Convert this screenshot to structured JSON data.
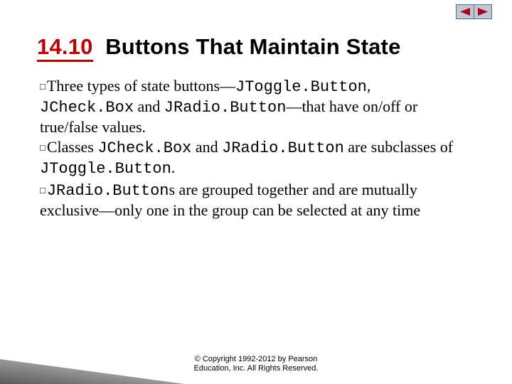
{
  "title": {
    "number": "14.10",
    "text": "Buttons That Maintain State"
  },
  "bullets": [
    {
      "runs": [
        {
          "t": "Three types of state buttons—"
        },
        {
          "t": "JToggle.Button",
          "mono": true
        },
        {
          "t": ", "
        },
        {
          "t": "JCheck.Box",
          "mono": true
        },
        {
          "t": " and "
        },
        {
          "t": "JRadio.Button",
          "mono": true
        },
        {
          "t": "—that have on/off or true/false values."
        }
      ]
    },
    {
      "runs": [
        {
          "t": "Classes "
        },
        {
          "t": "JCheck.Box",
          "mono": true
        },
        {
          "t": " and "
        },
        {
          "t": "JRadio.Button",
          "mono": true
        },
        {
          "t": " are subclasses of "
        },
        {
          "t": "JToggle.Button",
          "mono": true
        },
        {
          "t": "."
        }
      ]
    },
    {
      "runs": [
        {
          "t": "JRadio.Button",
          "mono": true
        },
        {
          "t": "s are grouped together and are mutually exclusive—only one in the group can be selected at any time"
        }
      ]
    }
  ],
  "bullet_marker": "□",
  "copyright": {
    "line1": "© Copyright 1992-2012 by Pearson",
    "line2": "Education, Inc. All Rights Reserved."
  },
  "nav": {
    "prev": "prev",
    "next": "next"
  },
  "colors": {
    "accent": "#c00000",
    "nav_bg": "#c0c8d4",
    "nav_border": "#5a6a82",
    "nav_arrow": "#b00020"
  }
}
